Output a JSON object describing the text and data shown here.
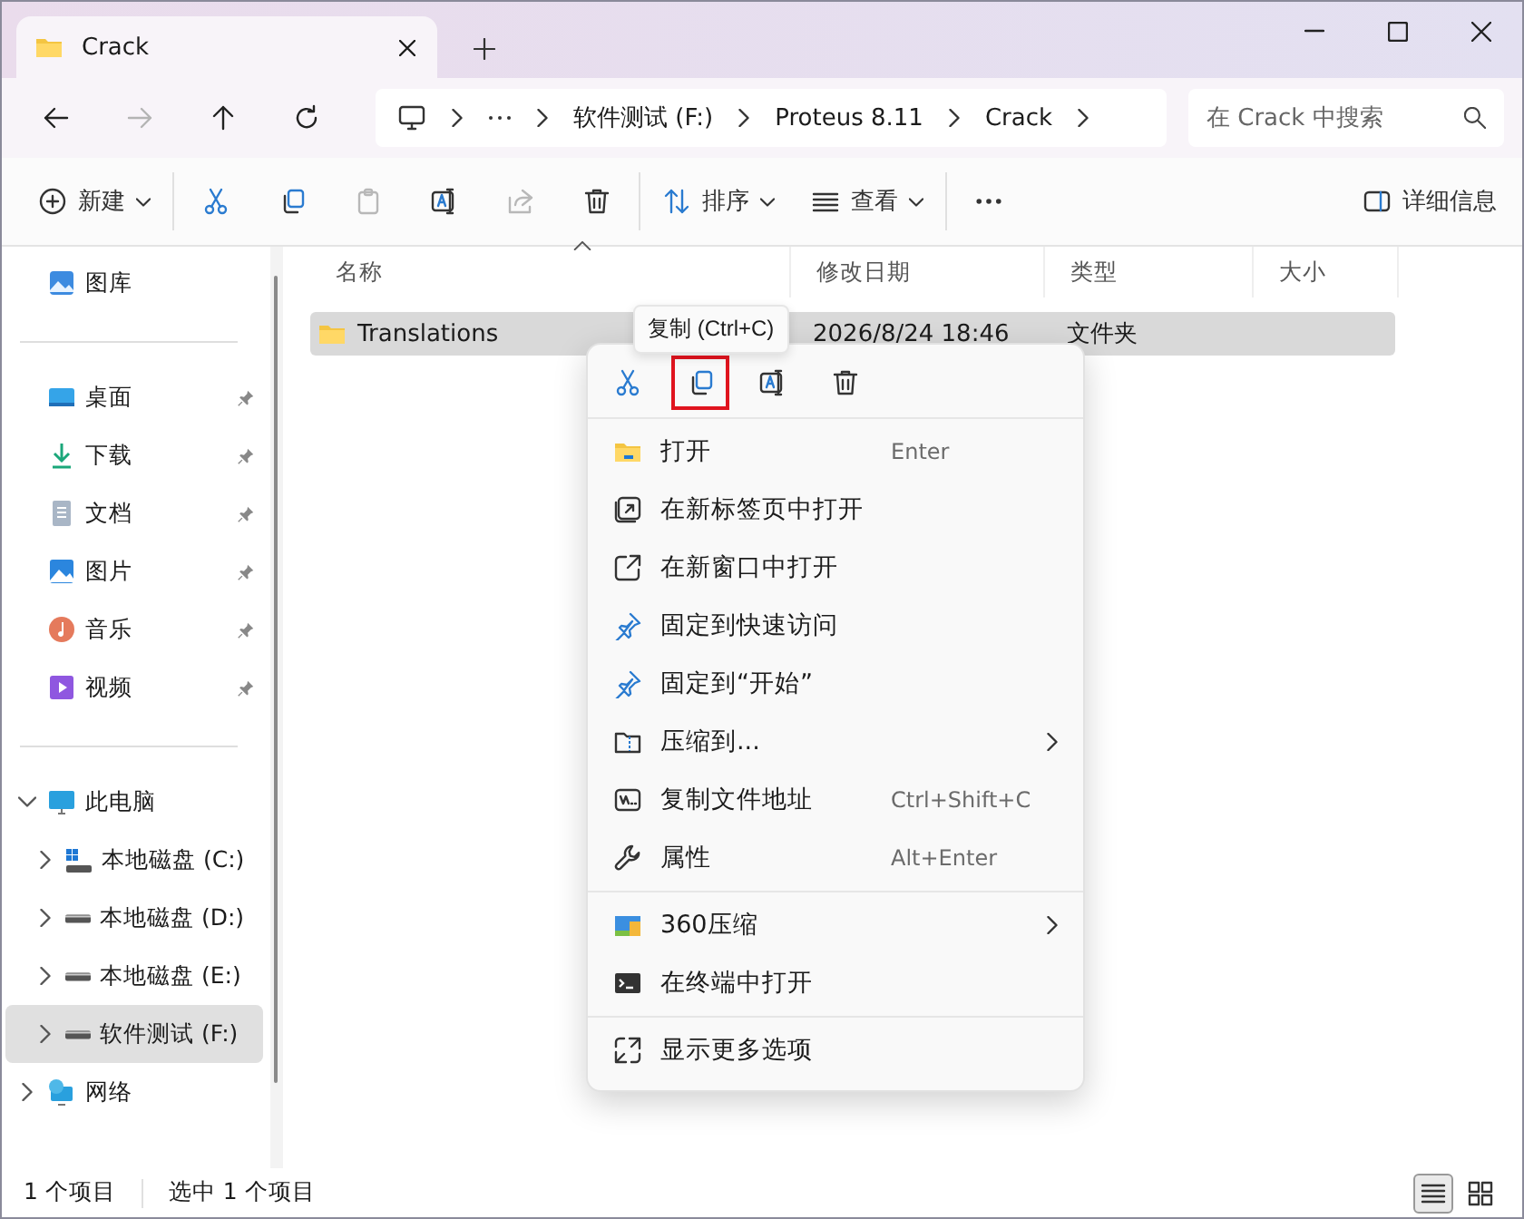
{
  "tab": {
    "title": "Crack"
  },
  "address": {
    "crumbs": [
      "软件测试 (F:)",
      "Proteus 8.11",
      "Crack"
    ],
    "search_placeholder": "在 Crack 中搜索"
  },
  "nav": [
    {
      "kind": "back",
      "disabled": false
    },
    {
      "kind": "forward",
      "disabled": true
    },
    {
      "kind": "up",
      "disabled": false
    },
    {
      "kind": "refresh",
      "disabled": false
    }
  ],
  "toolbar": {
    "groups": [
      [
        {
          "kind": "new",
          "label": "新建",
          "disabled": false
        }
      ],
      [
        {
          "kind": "cut",
          "disabled": false
        },
        {
          "kind": "copy",
          "disabled": false
        },
        {
          "kind": "paste",
          "disabled": true
        },
        {
          "kind": "rename",
          "disabled": false
        },
        {
          "kind": "share",
          "disabled": true
        },
        {
          "kind": "delete",
          "disabled": false
        }
      ],
      [
        {
          "kind": "sort",
          "label": "排序",
          "disabled": false
        },
        {
          "kind": "view",
          "label": "查看",
          "disabled": false
        }
      ],
      [
        {
          "kind": "more",
          "disabled": false
        }
      ]
    ],
    "details": {
      "label": "详细信息"
    }
  },
  "sidebar": {
    "sections": [
      [
        {
          "kind": "gallery",
          "label": "图库",
          "selected": false
        }
      ],
      [
        {
          "kind": "desktop",
          "label": "桌面",
          "pinned": true,
          "selected": false
        },
        {
          "kind": "downloads",
          "label": "下载",
          "pinned": true,
          "selected": false
        },
        {
          "kind": "documents",
          "label": "文档",
          "pinned": true,
          "selected": false
        },
        {
          "kind": "pictures",
          "label": "图片",
          "pinned": true,
          "selected": false
        },
        {
          "kind": "music",
          "label": "音乐",
          "pinned": true,
          "selected": false
        },
        {
          "kind": "videos",
          "label": "视频",
          "pinned": true,
          "selected": false
        }
      ],
      [
        {
          "kind": "pc",
          "label": "此电脑",
          "expanded": true,
          "selected": false,
          "children": [
            {
              "kind": "drive-system",
              "label": "本地磁盘 (C:)",
              "expanded": false,
              "selected": false
            },
            {
              "kind": "drive",
              "label": "本地磁盘 (D:)",
              "expanded": false,
              "selected": false
            },
            {
              "kind": "drive",
              "label": "本地磁盘 (E:)",
              "expanded": false,
              "selected": false
            },
            {
              "kind": "drive",
              "label": "软件测试 (F:)",
              "expanded": false,
              "selected": true
            }
          ]
        },
        {
          "kind": "network",
          "label": "网络",
          "expanded": false,
          "selected": false
        }
      ]
    ]
  },
  "table": {
    "columns": [
      "名称",
      "修改日期",
      "类型",
      "大小"
    ],
    "rows": [
      {
        "name": "Translations",
        "date": "2026/8/24 18:46",
        "type": "文件夹",
        "selected": true
      }
    ]
  },
  "tooltip": "复制 (Ctrl+C)",
  "context_menu": {
    "quick_actions": [
      {
        "kind": "cut",
        "highlighted": false
      },
      {
        "kind": "copy",
        "highlighted": true
      },
      {
        "kind": "rename",
        "highlighted": false
      },
      {
        "kind": "delete",
        "highlighted": false
      }
    ],
    "groups": [
      [
        {
          "kind": "open",
          "label": "打开",
          "shortcut": "Enter",
          "submenu": false
        },
        {
          "kind": "new-tab",
          "label": "在新标签页中打开",
          "submenu": false
        },
        {
          "kind": "new-window",
          "label": "在新窗口中打开",
          "submenu": false
        },
        {
          "kind": "pin",
          "label": "固定到快速访问",
          "submenu": false
        },
        {
          "kind": "pin",
          "label": "固定到“开始”",
          "submenu": false
        },
        {
          "kind": "compress",
          "label": "压缩到...",
          "submenu": true
        },
        {
          "kind": "copy-path",
          "label": "复制文件地址",
          "shortcut": "Ctrl+Shift+C",
          "submenu": false
        },
        {
          "kind": "properties",
          "label": "属性",
          "shortcut": "Alt+Enter",
          "submenu": false
        }
      ],
      [
        {
          "kind": "zip360",
          "label": "360压缩",
          "submenu": true
        },
        {
          "kind": "terminal",
          "label": "在终端中打开",
          "submenu": false
        }
      ],
      [
        {
          "kind": "more-options",
          "label": "显示更多选项",
          "submenu": false
        }
      ]
    ]
  },
  "status_bar": {
    "count": "1 个项目",
    "selection": "选中 1 个项目",
    "views": [
      {
        "kind": "details",
        "selected": true
      },
      {
        "kind": "tiles",
        "selected": false
      }
    ]
  }
}
